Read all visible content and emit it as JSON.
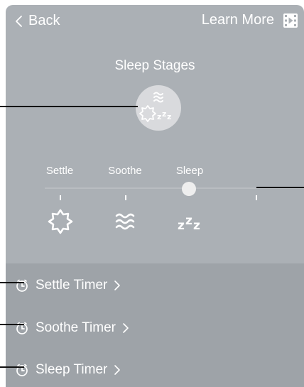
{
  "header": {
    "back_label": "Back",
    "learn_more_label": "Learn More"
  },
  "stages": {
    "title": "Sleep Stages",
    "items": [
      {
        "label": "Settle",
        "icon": "sun-icon"
      },
      {
        "label": "Soothe",
        "icon": "waves-icon"
      },
      {
        "label": "Sleep",
        "icon": "zzz-icon"
      }
    ],
    "selected_index": 2
  },
  "timers": [
    {
      "label": "Settle Timer"
    },
    {
      "label": "Soothe Timer"
    },
    {
      "label": "Sleep Timer"
    }
  ],
  "colors": {
    "screen_bg": "#abb0b5",
    "timers_bg": "#9ea3a8",
    "text": "#ffffff",
    "badge_bg": "#d9dadd",
    "callout": "#111111"
  }
}
